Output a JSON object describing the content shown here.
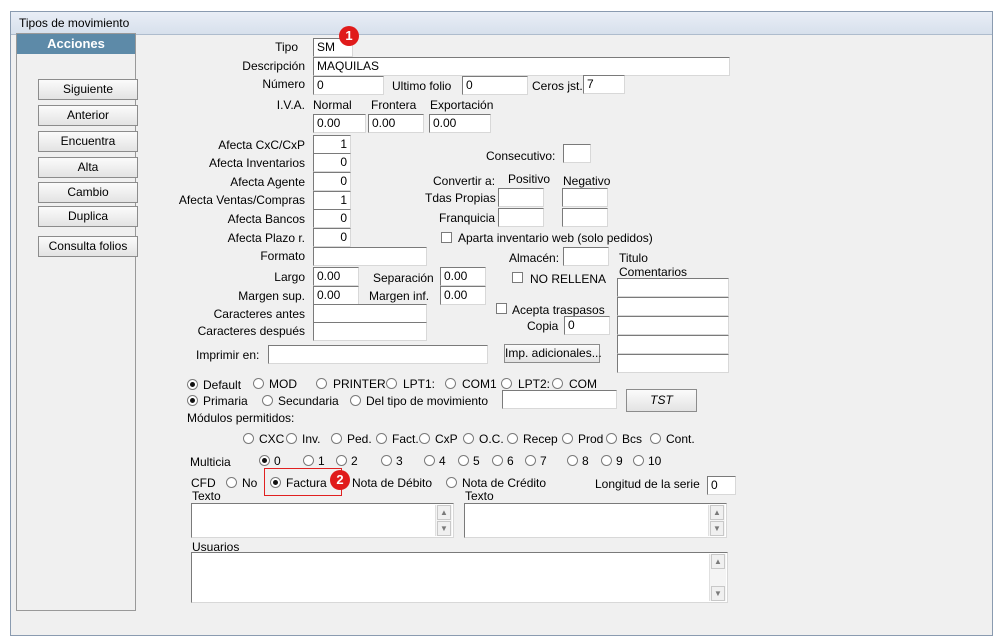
{
  "window": {
    "title": "Tipos de movimiento"
  },
  "acciones": {
    "header": "Acciones",
    "buttons": [
      "Siguiente",
      "Anterior",
      "Encuentra",
      "Alta",
      "Cambio",
      "Duplica",
      "Consulta folios"
    ]
  },
  "form": {
    "tipo": {
      "label": "Tipo",
      "value": "SM"
    },
    "descripcion": {
      "label": "Descripción",
      "value": "MAQUILAS"
    },
    "numero": {
      "label": "Número",
      "value": "0"
    },
    "ultimo_folio": {
      "label": "Ultimo folio",
      "value": "0"
    },
    "ceros_jst": {
      "label": "Ceros jst.",
      "value": "7"
    },
    "iva": {
      "label": "I.V.A.",
      "normal_label": "Normal",
      "frontera_label": "Frontera",
      "exportacion_label": "Exportación",
      "normal": "0.00",
      "frontera": "0.00",
      "exportacion": "0.00"
    },
    "afecta": [
      {
        "label": "Afecta  CxC/CxP",
        "value": "1"
      },
      {
        "label": "Afecta  Inventarios",
        "value": "0"
      },
      {
        "label": "Afecta  Agente",
        "value": "0"
      },
      {
        "label": "Afecta  Ventas/Compras",
        "value": "1"
      },
      {
        "label": "Afecta  Bancos",
        "value": "0"
      },
      {
        "label": "Afecta  Plazo r.",
        "value": "0"
      }
    ],
    "consecutivo": {
      "label": "Consecutivo:",
      "value": ""
    },
    "convertir": {
      "label": "Convertir a:",
      "positivo": "Positivo",
      "negativo": "Negativo",
      "tdas_propias": "Tdas Propias",
      "franquicia": "Franquicia"
    },
    "aparta_inventario": "Aparta inventario web (solo pedidos)",
    "formato": {
      "label": "Formato",
      "value": ""
    },
    "almacen": {
      "label": "Almacén:",
      "value": ""
    },
    "titulo_comentarios": [
      "Titulo",
      "Comentarios"
    ],
    "largo": {
      "label": "Largo",
      "value": "0.00"
    },
    "separacion": {
      "label": "Separación",
      "value": "0.00"
    },
    "no_rellena": "NO RELLENA",
    "margen_sup": {
      "label": "Margen sup.",
      "value": "0.00"
    },
    "margen_inf": {
      "label": "Margen inf.",
      "value": "0.00"
    },
    "acepta_traspasos": "Acepta traspasos",
    "caracteres_antes": {
      "label": "Caracteres antes",
      "value": ""
    },
    "copia": {
      "label": "Copia",
      "value": "0"
    },
    "caracteres_despues": {
      "label": "Caracteres después",
      "value": ""
    },
    "imprimir_en": {
      "label": "Imprimir en:",
      "value": ""
    },
    "imp_adicionales": "Imp. adicionales...",
    "printer_options": [
      "Default",
      "MOD",
      "PRINTER",
      "LPT1:",
      "COM1",
      "LPT2:",
      "COM"
    ],
    "printer_selected": "Default",
    "primaria_options": [
      "Primaria",
      "Secundaria",
      "Del tipo de movimiento"
    ],
    "primaria_selected": "Primaria",
    "tst_button": "TST",
    "modulos_label": "Módulos permitidos:",
    "modulos": [
      "CXC",
      "Inv.",
      "Ped.",
      "Fact.",
      "CxP",
      "O.C.",
      "Recep",
      "Prod",
      "Bcs",
      "Cont."
    ],
    "multicia": {
      "label": "Multicia",
      "options": [
        "0",
        "1",
        "2",
        "3",
        "4",
        "5",
        "6",
        "7",
        "8",
        "9",
        "10"
      ],
      "selected": "0"
    },
    "cfd": {
      "label": "CFD",
      "options": [
        "No",
        "Factura",
        "Nota de Débito",
        "Nota de Crédito"
      ],
      "selected": "Factura"
    },
    "longitud_serie": {
      "label": "Longitud de la serie",
      "value": "0"
    },
    "texto1_label": "Texto",
    "texto2_label": "Texto",
    "usuarios_label": "Usuarios"
  },
  "callouts": [
    "1",
    "2"
  ],
  "colors": {
    "acciones_header": "#5d8aa8",
    "callout": "#e01b1b"
  }
}
